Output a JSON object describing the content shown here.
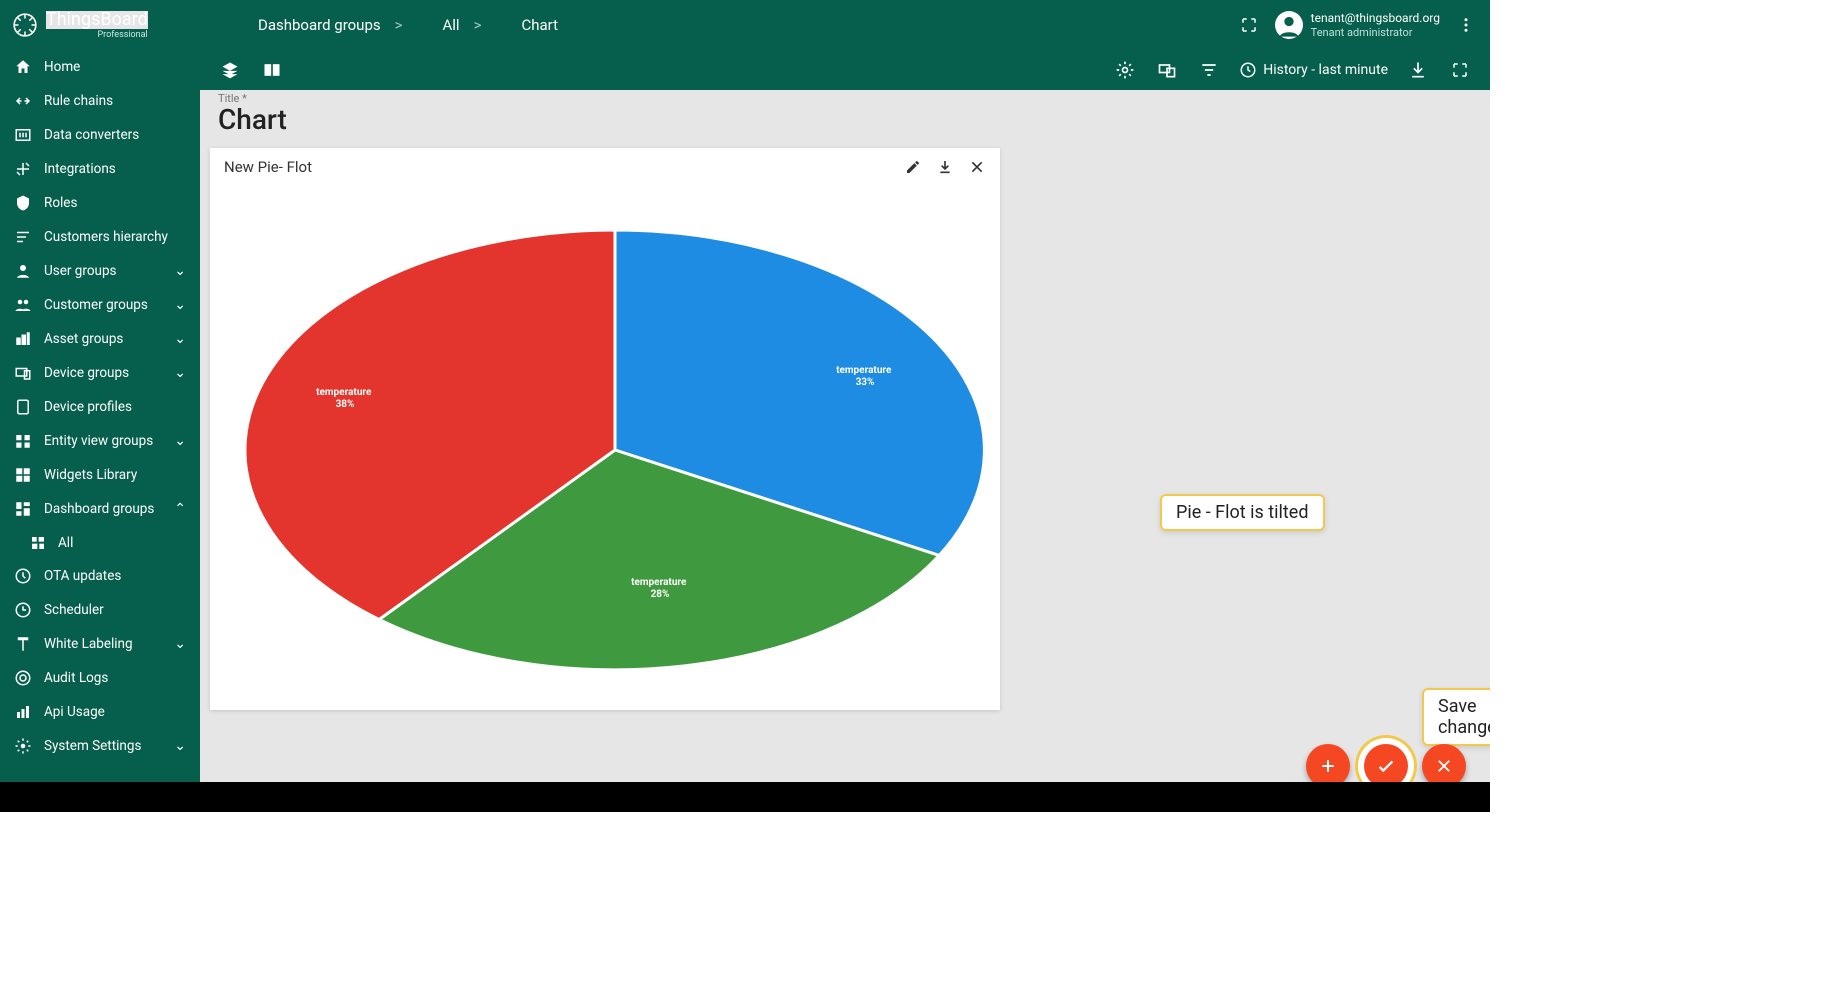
{
  "brand": {
    "name": "ThingsBoard",
    "edition": "Professional"
  },
  "breadcrumbs": [
    {
      "label": "Dashboard groups"
    },
    {
      "label": "All"
    },
    {
      "label": "Chart"
    }
  ],
  "user": {
    "email": "tenant@thingsboard.org",
    "role": "Tenant administrator"
  },
  "sidebar": {
    "items": [
      {
        "label": "Home",
        "icon": "home"
      },
      {
        "label": "Rule chains",
        "icon": "rulechains"
      },
      {
        "label": "Data converters",
        "icon": "converters"
      },
      {
        "label": "Integrations",
        "icon": "integrations"
      },
      {
        "label": "Roles",
        "icon": "roles"
      },
      {
        "label": "Customers hierarchy",
        "icon": "hierarchy"
      },
      {
        "label": "User groups",
        "icon": "user",
        "expandable": true
      },
      {
        "label": "Customer groups",
        "icon": "customers",
        "expandable": true
      },
      {
        "label": "Asset groups",
        "icon": "assets",
        "expandable": true
      },
      {
        "label": "Device groups",
        "icon": "devices",
        "expandable": true
      },
      {
        "label": "Device profiles",
        "icon": "profile"
      },
      {
        "label": "Entity view groups",
        "icon": "entityview",
        "expandable": true
      },
      {
        "label": "Widgets Library",
        "icon": "widgets"
      },
      {
        "label": "Dashboard groups",
        "icon": "dashboards",
        "expandable": true,
        "expanded": true,
        "children": [
          {
            "label": "All"
          }
        ]
      },
      {
        "label": "OTA updates",
        "icon": "ota"
      },
      {
        "label": "Scheduler",
        "icon": "scheduler"
      },
      {
        "label": "White Labeling",
        "icon": "whitelabel",
        "expandable": true
      },
      {
        "label": "Audit Logs",
        "icon": "audit"
      },
      {
        "label": "Api Usage",
        "icon": "api"
      },
      {
        "label": "System Settings",
        "icon": "settings",
        "expandable": true
      }
    ]
  },
  "toolbar": {
    "timewindow": "History - last minute"
  },
  "page": {
    "title_label": "Title *",
    "title": "Chart"
  },
  "widget": {
    "title": "New Pie- Flot"
  },
  "chart_data": {
    "type": "pie",
    "title": "New Pie- Flot",
    "tilted": true,
    "series": [
      {
        "name": "temperature",
        "value": 33,
        "percent_label": "33%",
        "color": "#1f8ce3"
      },
      {
        "name": "temperature",
        "value": 28,
        "percent_label": "28%",
        "color": "#3f9a3f"
      },
      {
        "name": "temperature",
        "value": 38,
        "percent_label": "38%",
        "color": "#e3352d"
      }
    ]
  },
  "callouts": {
    "tilt": "Pie - Flot is tilted",
    "save": "Save changes"
  },
  "colors": {
    "primary": "#065f4c",
    "accent": "#f44722",
    "highlight": "#f2c94c"
  }
}
